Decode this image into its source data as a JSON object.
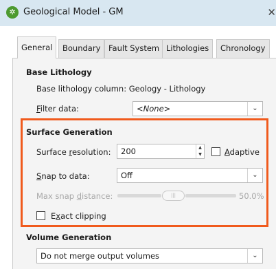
{
  "window": {
    "title": "Geological Model - GM",
    "app_icon_glyph": "✲",
    "close_glyph": "✕"
  },
  "tabs": [
    {
      "label": "General",
      "active": true
    },
    {
      "label": "Boundary",
      "active": false
    },
    {
      "label": "Fault System",
      "active": false
    },
    {
      "label": "Lithologies",
      "active": false
    },
    {
      "label": "Chronology",
      "active": false
    }
  ],
  "base_lithology": {
    "heading": "Base Lithology",
    "column_text": "Base lithology column: Geology - Lithology",
    "filter_label_mnemonic": "F",
    "filter_label_rest": "ilter data:",
    "filter_value": "<None>"
  },
  "surface_generation": {
    "heading": "Surface Generation",
    "resolution_label_prefix": "Surface ",
    "resolution_label_mnemonic": "r",
    "resolution_label_rest": "esolution:",
    "resolution_value": "200",
    "adaptive_label_mnemonic": "A",
    "adaptive_label_rest": "daptive",
    "adaptive_checked": false,
    "snap_label_mnemonic": "S",
    "snap_label_rest": "nap to data:",
    "snap_value": "Off",
    "max_snap_label_prefix": "Max snap ",
    "max_snap_label_mnemonic": "d",
    "max_snap_label_rest": "istance:",
    "max_snap_percent_text": "50.0%",
    "max_snap_fraction": 0.5,
    "slider_grip": "|||",
    "exact_clipping_label_prefix": "E",
    "exact_clipping_label_mnemonic": "x",
    "exact_clipping_label_rest": "act clipping",
    "exact_clipping_checked": false
  },
  "volume_generation": {
    "heading": "Volume Generation",
    "value": "Do not merge output volumes"
  },
  "icons": {
    "chevron": "chevron-down-icon",
    "spin_up": "▲",
    "spin_down": "▼",
    "chevron_glyph": "⌄"
  },
  "colors": {
    "highlight": "#f05a1d",
    "titlebar": "#d8e7f1",
    "app_icon": "#4d9a2f"
  }
}
